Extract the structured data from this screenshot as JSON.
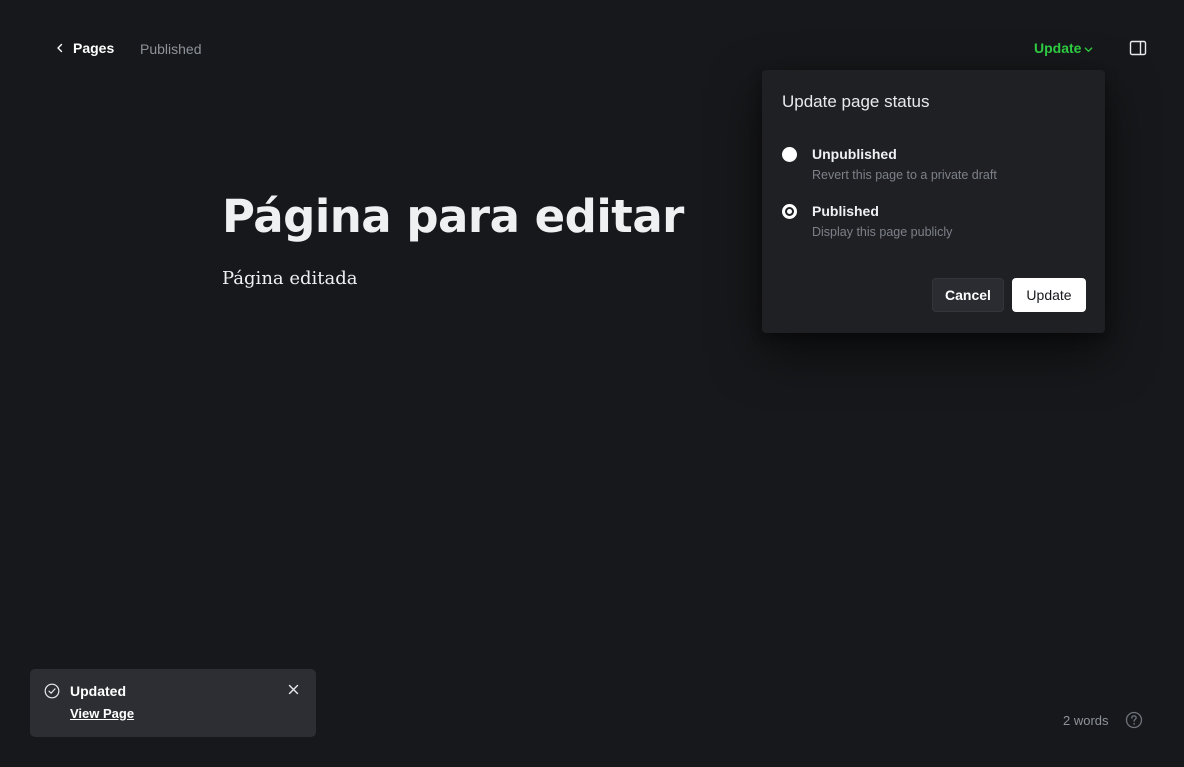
{
  "header": {
    "back_label": "Pages",
    "status": "Published",
    "update_label": "Update"
  },
  "editor": {
    "title": "Página para editar",
    "body": "Página editada"
  },
  "popover": {
    "title": "Update page status",
    "options": [
      {
        "label": "Unpublished",
        "description": "Revert this page to a private draft",
        "selected": false
      },
      {
        "label": "Published",
        "description": "Display this page publicly",
        "selected": true
      }
    ],
    "cancel_label": "Cancel",
    "confirm_label": "Update"
  },
  "toast": {
    "title": "Updated",
    "link_label": "View Page"
  },
  "footer": {
    "word_count": "2 words"
  },
  "colors": {
    "accent_green": "#30cf43",
    "background": "#17181b",
    "popover_bg": "#1f2024"
  },
  "icons": {
    "back": "chevron-left-icon",
    "update_dropdown": "chevron-down-icon",
    "sidebar": "sidebar-toggle-icon",
    "toast_status": "check-circle-icon",
    "toast_close": "close-icon",
    "help": "question-circle-icon"
  }
}
